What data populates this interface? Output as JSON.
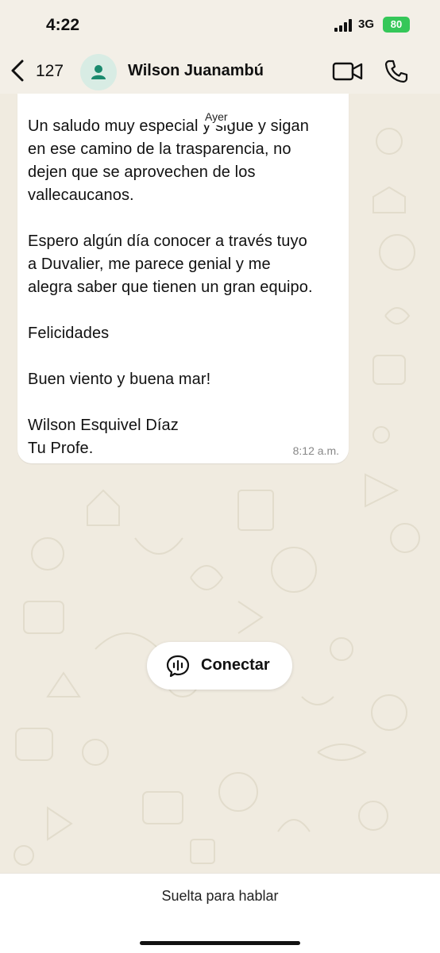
{
  "status_bar": {
    "time": "4:22",
    "network": "3G",
    "battery": "80"
  },
  "header": {
    "back_count": "127",
    "contact_name": "Wilson Juanambú"
  },
  "date_separator": "Ayer",
  "message": {
    "text": "Un saludo muy especial y sigue y sigan\nen ese camino de la trasparencia, no\ndejen que se aprovechen de los\nvallecaucanos.\n\nEspero algún día conocer a través tuyo\na Duvalier, me parece genial y me\nalegra saber que tienen un gran equipo.\n\nFelicidades\n\nBuen viento y buena mar!\n\nWilson Esquivel Díaz\nTu Profe.",
    "time": "8:12 a.m."
  },
  "connect_button": {
    "label": "Conectar"
  },
  "bottom": {
    "hint": "Suelta para hablar"
  },
  "colors": {
    "wallpaper": "#f0ebe0",
    "bubble": "#ffffff",
    "battery": "#35c759",
    "accent": "#1a8a6e"
  },
  "icons": [
    "back-chevron-icon",
    "contact-avatar-icon",
    "video-call-icon",
    "phone-call-icon",
    "connect-icon",
    "signal-icon"
  ]
}
